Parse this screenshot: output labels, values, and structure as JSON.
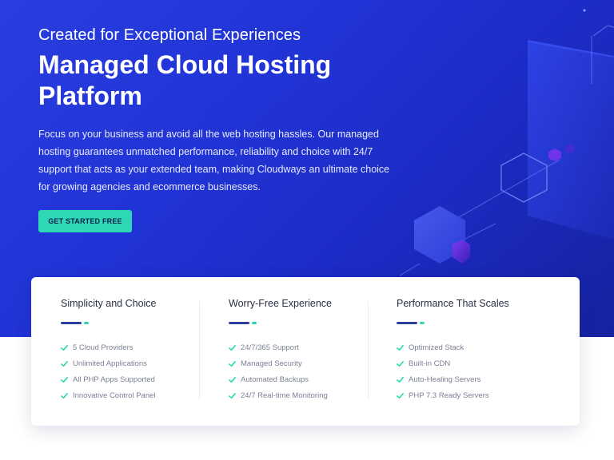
{
  "hero": {
    "eyebrow": "Created for Exceptional Experiences",
    "title": "Managed Cloud Hosting Platform",
    "description": "Focus on your business and avoid all the web hosting hassles. Our managed hosting guarantees unmatched performance, reliability and choice with 24/7 support that acts as your extended team, making Cloudways an ultimate choice for growing agencies and ecommerce businesses.",
    "cta_label": "GET STARTED FREE"
  },
  "features": [
    {
      "title": "Simplicity and Choice",
      "items": [
        "5 Cloud Providers",
        "Unlimited Applications",
        "All PHP Apps Supported",
        "Innovative Control Panel"
      ]
    },
    {
      "title": "Worry-Free Experience",
      "items": [
        "24/7/365 Support",
        "Managed Security",
        "Automated Backups",
        "24/7 Real-time Monitoring"
      ]
    },
    {
      "title": "Performance That Scales",
      "items": [
        "Optimized Stack",
        "Built-in CDN",
        "Auto-Healing Servers",
        "PHP 7.3 Ready Servers"
      ]
    }
  ],
  "colors": {
    "hero_background": "#2134d6",
    "cta_background": "#2ed8b4",
    "check_color": "#2ed8b4",
    "accent_dark": "#2c3f9c"
  },
  "icons": {
    "feature_bullet": "check-icon"
  }
}
